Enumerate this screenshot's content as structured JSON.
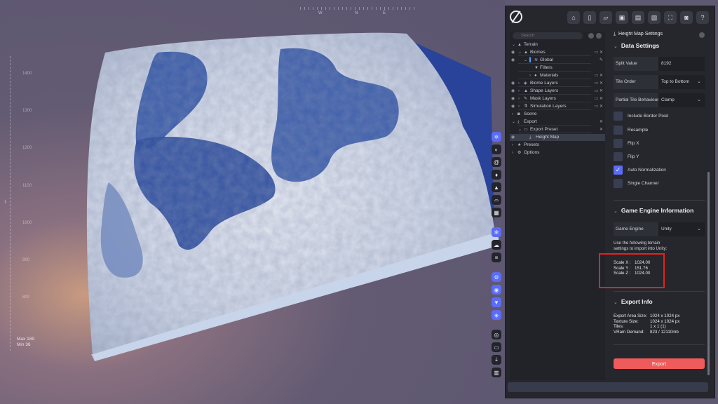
{
  "viewport": {
    "compass": [
      "W",
      "N",
      "E"
    ],
    "ruler_ticks": [
      "1400",
      "1300",
      "1200",
      "1100",
      "1000",
      "900",
      "800"
    ],
    "min_max": [
      "Max 189",
      "Min 36"
    ],
    "tools": [
      "gear-icon",
      "contrast-icon",
      "tornado-icon",
      "flame-icon",
      "mountain-icon",
      "sun-horizon-icon",
      "grid-icon",
      "snowflake-icon",
      "cloud-icon",
      "lines-icon",
      "gears-icon",
      "eye-icon",
      "filter-icon",
      "layers-icon",
      "target-icon",
      "folder-icon",
      "download-icon",
      "chart-icon"
    ]
  },
  "toolbar": {
    "buttons": [
      "home-icon",
      "file-icon",
      "open-folder-icon",
      "save-icon",
      "save-as-icon",
      "save-export-icon",
      "fullscreen-icon",
      "camera-icon",
      "help-icon"
    ]
  },
  "tree": {
    "search_placeholder": "Search",
    "items": [
      {
        "label": "Terrain"
      },
      {
        "label": "Biomes"
      },
      {
        "label": "Global"
      },
      {
        "label": "Filters"
      },
      {
        "label": "Materials"
      },
      {
        "label": "Biome Layers"
      },
      {
        "label": "Shape Layers"
      },
      {
        "label": "Mask Layers"
      },
      {
        "label": "Simulation Layers"
      },
      {
        "label": "Scene"
      },
      {
        "label": "Export"
      },
      {
        "label": "Export Preset"
      },
      {
        "label": "Height Map"
      },
      {
        "label": "Presets"
      },
      {
        "label": "Options"
      }
    ]
  },
  "settings": {
    "header": "Height Map Settings",
    "data_settings": {
      "title": "Data Settings",
      "split_label": "Split Value",
      "split_value": "8192",
      "tile_order_label": "Tile Order",
      "tile_order_value": "Top to Bottom",
      "partial_label": "Partial Tile Behaviour",
      "partial_value": "Clamp",
      "checks": [
        {
          "label": "Include Border Pixel",
          "checked": false
        },
        {
          "label": "Resample",
          "checked": false
        },
        {
          "label": "Flip X",
          "checked": false
        },
        {
          "label": "Flip Y",
          "checked": false
        },
        {
          "label": "Auto Normalization",
          "checked": true
        },
        {
          "label": "Single Channel",
          "checked": false
        }
      ]
    },
    "game_engine": {
      "title": "Game Engine Information",
      "engine_label": "Game Engine",
      "engine_value": "Unity",
      "note_line1": "Use the following terrain",
      "note_line2": "settings to import into Unity:",
      "scale_x_label": "Scale X :",
      "scale_x": "1024.00",
      "scale_y_label": "Scale Y :",
      "scale_y": "151.76",
      "scale_z_label": "Scale Z :",
      "scale_z": "1024.00"
    },
    "export_info": {
      "title": "Export Info",
      "area_label": "Export Area Size:",
      "area_value": "1024 x 1024 px",
      "texture_label": "Texture Size:",
      "texture_value": "1024 x 1024 px",
      "tiles_label": "Tiles:",
      "tiles_value": "1 x 1   (1)",
      "vram_label": "VRam Demand:",
      "vram_value": "823 / 12110mb"
    },
    "export_button": "Export"
  },
  "colors": {
    "accent": "#5b6cf7",
    "export": "#ef5a5a",
    "highlight": "#e81f1f",
    "terrain_blue": "#2a4fa3"
  }
}
